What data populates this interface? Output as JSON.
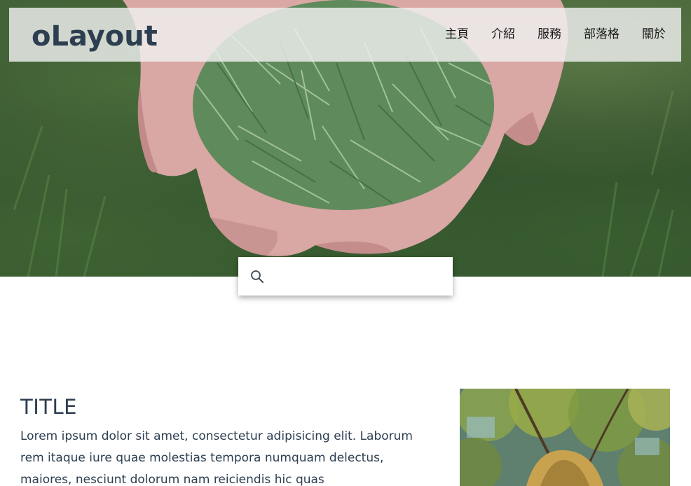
{
  "header": {
    "brand": "oLayout",
    "nav": [
      {
        "label": "主頁"
      },
      {
        "label": "介紹"
      },
      {
        "label": "服務"
      },
      {
        "label": "部落格"
      },
      {
        "label": "關於"
      }
    ]
  },
  "hero": {
    "image": "hands-holding-pine-needles"
  },
  "search": {
    "icon": "search-icon",
    "value": "",
    "placeholder": ""
  },
  "content": {
    "title": "TITLE",
    "body": "Lorem ipsum dolor sit amet, consectetur adipisicing elit. Laborum rem itaque iure quae molestias tempora numquam delectus, maiores, nesciunt dolorum nam reiciendis hic quas",
    "side_image": "tree-canopy-photo"
  },
  "colors": {
    "brand": "#2c3e50",
    "text": "#2c3e50",
    "navbar_bg": "#f0f0f0"
  }
}
